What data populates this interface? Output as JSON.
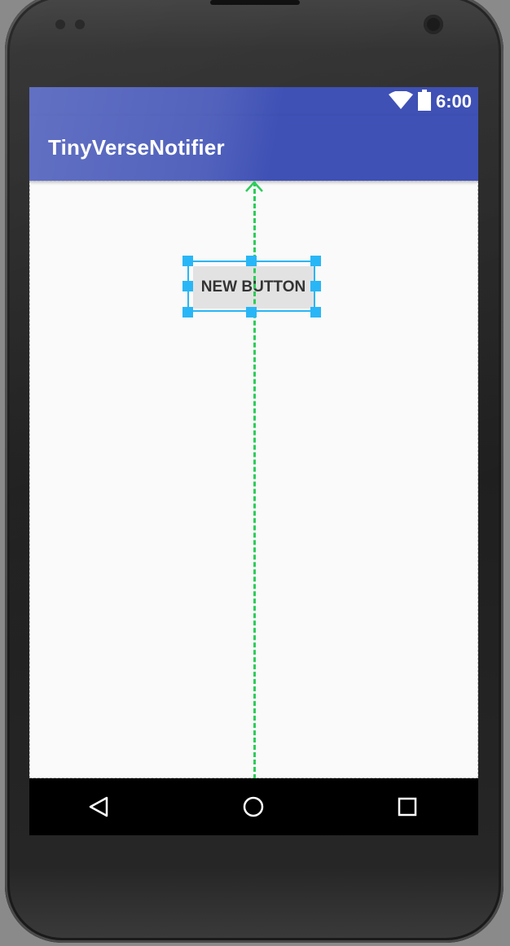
{
  "status_bar": {
    "time": "6:00",
    "icons": [
      "wifi-icon",
      "battery-icon"
    ]
  },
  "app_bar": {
    "title": "TinyVerseNotifier"
  },
  "main": {
    "button_label": "NEW BUTTON"
  },
  "nav_bar": {
    "items": [
      "back-icon",
      "home-icon",
      "recents-icon"
    ]
  },
  "colors": {
    "primary": "#3f51b5",
    "selection": "#29b6f6",
    "guide": "#2ecc5a",
    "button": "#e2e2e2"
  }
}
